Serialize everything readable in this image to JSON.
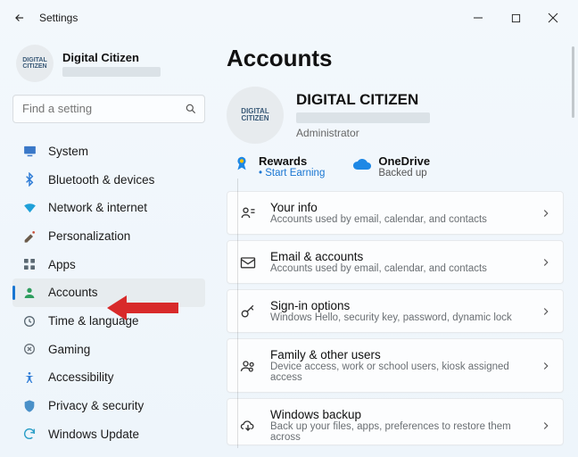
{
  "window": {
    "title": "Settings"
  },
  "user": {
    "name": "Digital Citizen",
    "avatar_text": "DIGITAL\nCITIZEN"
  },
  "search": {
    "placeholder": "Find a setting"
  },
  "nav": [
    {
      "label": "System"
    },
    {
      "label": "Bluetooth & devices"
    },
    {
      "label": "Network & internet"
    },
    {
      "label": "Personalization"
    },
    {
      "label": "Apps"
    },
    {
      "label": "Accounts"
    },
    {
      "label": "Time & language"
    },
    {
      "label": "Gaming"
    },
    {
      "label": "Accessibility"
    },
    {
      "label": "Privacy & security"
    },
    {
      "label": "Windows Update"
    }
  ],
  "page": {
    "title": "Accounts",
    "account": {
      "name": "DIGITAL CITIZEN",
      "role": "Administrator",
      "avatar_text": "DIGITAL\nCITIZEN"
    },
    "tiles": {
      "rewards": {
        "label": "Rewards",
        "sub": "• Start Earning"
      },
      "onedrive": {
        "label": "OneDrive",
        "sub": "Backed up"
      }
    },
    "cards": [
      {
        "title": "Your info",
        "sub": "Accounts used by email, calendar, and contacts"
      },
      {
        "title": "Email & accounts",
        "sub": "Accounts used by email, calendar, and contacts"
      },
      {
        "title": "Sign-in options",
        "sub": "Windows Hello, security key, password, dynamic lock"
      },
      {
        "title": "Family & other users",
        "sub": "Device access, work or school users, kiosk assigned access"
      },
      {
        "title": "Windows backup",
        "sub": "Back up your files, apps, preferences to restore them across"
      }
    ]
  }
}
